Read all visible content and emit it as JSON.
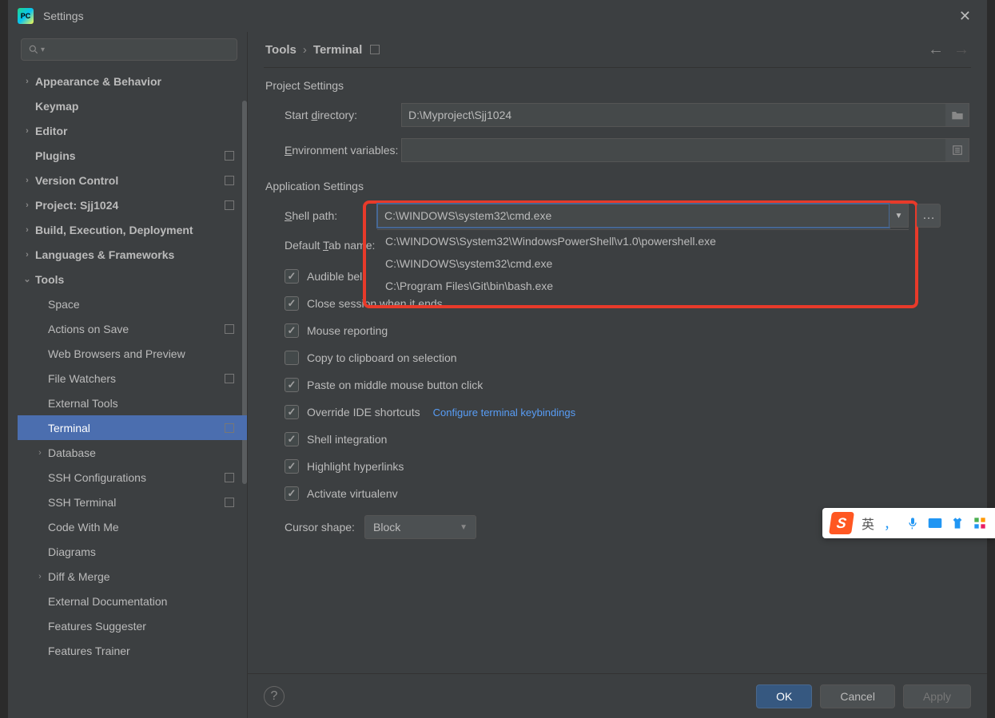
{
  "titlebar": {
    "title": "Settings"
  },
  "sidebar": {
    "items": [
      {
        "label": "Appearance & Behavior",
        "bold": true,
        "arrow": "›",
        "level": 0
      },
      {
        "label": "Keymap",
        "bold": true,
        "level": 0
      },
      {
        "label": "Editor",
        "bold": true,
        "arrow": "›",
        "level": 0
      },
      {
        "label": "Plugins",
        "bold": true,
        "badge": true,
        "level": 0
      },
      {
        "label": "Version Control",
        "bold": true,
        "arrow": "›",
        "badge": true,
        "level": 0
      },
      {
        "label": "Project: Sjj1024",
        "bold": true,
        "arrow": "›",
        "badge": true,
        "level": 0
      },
      {
        "label": "Build, Execution, Deployment",
        "bold": true,
        "arrow": "›",
        "level": 0
      },
      {
        "label": "Languages & Frameworks",
        "bold": true,
        "arrow": "›",
        "level": 0
      },
      {
        "label": "Tools",
        "bold": true,
        "arrow": "⌄",
        "level": 0
      },
      {
        "label": "Space",
        "level": 1
      },
      {
        "label": "Actions on Save",
        "badge": true,
        "level": 1
      },
      {
        "label": "Web Browsers and Preview",
        "level": 1
      },
      {
        "label": "File Watchers",
        "badge": true,
        "level": 1
      },
      {
        "label": "External Tools",
        "level": 1
      },
      {
        "label": "Terminal",
        "selected": true,
        "badge": true,
        "level": 1
      },
      {
        "label": "Database",
        "arrow": "›",
        "level": 1
      },
      {
        "label": "SSH Configurations",
        "badge": true,
        "level": 1
      },
      {
        "label": "SSH Terminal",
        "badge": true,
        "level": 1
      },
      {
        "label": "Code With Me",
        "level": 1
      },
      {
        "label": "Diagrams",
        "level": 1
      },
      {
        "label": "Diff & Merge",
        "arrow": "›",
        "level": 1
      },
      {
        "label": "External Documentation",
        "level": 1
      },
      {
        "label": "Features Suggester",
        "level": 1
      },
      {
        "label": "Features Trainer",
        "level": 1
      }
    ]
  },
  "breadcrumb": {
    "root": "Tools",
    "leaf": "Terminal"
  },
  "project_settings": {
    "title": "Project Settings",
    "start_dir_label": "Start directory:",
    "start_dir_value": "D:\\Myproject\\Sjj1024",
    "env_label": "Environment variables:",
    "env_value": ""
  },
  "app_settings": {
    "title": "Application Settings",
    "shell_label": "Shell path:",
    "shell_value": "C:\\WINDOWS\\system32\\cmd.exe",
    "shell_options": [
      "C:\\WINDOWS\\System32\\WindowsPowerShell\\v1.0\\powershell.exe",
      "C:\\WINDOWS\\system32\\cmd.exe",
      "C:\\Program Files\\Git\\bin\\bash.exe"
    ],
    "tab_name_label": "Default Tab name:",
    "checks": [
      {
        "label": "Audible bell",
        "checked": true
      },
      {
        "label": "Close session when it ends",
        "checked": true
      },
      {
        "label": "Mouse reporting",
        "checked": true
      },
      {
        "label": "Copy to clipboard on selection",
        "checked": false
      },
      {
        "label": "Paste on middle mouse button click",
        "checked": true
      },
      {
        "label": "Override IDE shortcuts",
        "checked": true,
        "link": "Configure terminal keybindings"
      },
      {
        "label": "Shell integration",
        "checked": true
      },
      {
        "label": "Highlight hyperlinks",
        "checked": true
      },
      {
        "label": "Activate virtualenv",
        "checked": true
      }
    ],
    "cursor_label": "Cursor shape:",
    "cursor_value": "Block"
  },
  "buttons": {
    "ok": "OK",
    "cancel": "Cancel",
    "apply": "Apply"
  },
  "ime": {
    "lang": "英",
    "comma": "，"
  }
}
